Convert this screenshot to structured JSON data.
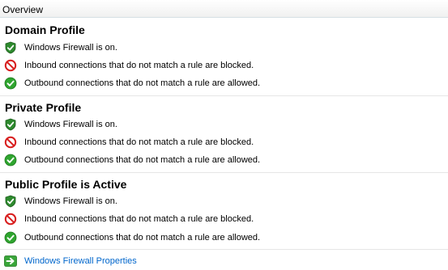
{
  "header": {
    "title": "Overview"
  },
  "profiles": [
    {
      "title": "Domain Profile",
      "items": [
        {
          "icon": "shield-check-icon",
          "text": "Windows Firewall is on."
        },
        {
          "icon": "blocked-icon",
          "text": "Inbound connections that do not match a rule are blocked."
        },
        {
          "icon": "allowed-check-icon",
          "text": "Outbound connections that do not match a rule are allowed."
        }
      ]
    },
    {
      "title": "Private Profile",
      "items": [
        {
          "icon": "shield-check-icon",
          "text": "Windows Firewall is on."
        },
        {
          "icon": "blocked-icon",
          "text": "Inbound connections that do not match a rule are blocked."
        },
        {
          "icon": "allowed-check-icon",
          "text": "Outbound connections that do not match a rule are allowed."
        }
      ]
    },
    {
      "title": "Public Profile is Active",
      "items": [
        {
          "icon": "shield-check-icon",
          "text": "Windows Firewall is on."
        },
        {
          "icon": "blocked-icon",
          "text": "Inbound connections that do not match a rule are blocked."
        },
        {
          "icon": "allowed-check-icon",
          "text": "Outbound connections that do not match a rule are allowed."
        }
      ]
    }
  ],
  "footer": {
    "link_icon": "arrow-right-icon",
    "link_label": "Windows Firewall Properties"
  },
  "colors": {
    "link": "#0066cc",
    "shield": "#2e8a2e",
    "blocked": "#d81e1e",
    "allowed": "#2fa52f"
  }
}
